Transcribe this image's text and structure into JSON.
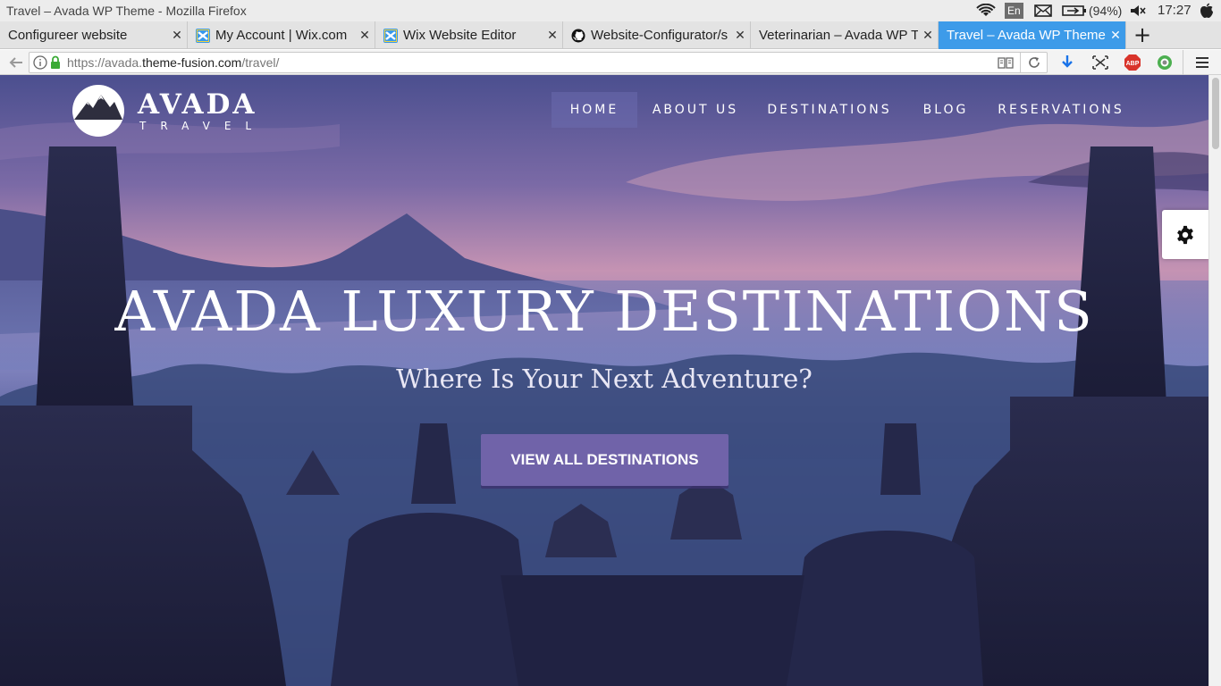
{
  "window": {
    "title": "Travel – Avada WP Theme - Mozilla Firefox"
  },
  "system_tray": {
    "language": "En",
    "battery": "(94%)",
    "clock": "17:27",
    "icons": [
      "wifi-icon",
      "mail-icon",
      "battery-icon",
      "mute-icon",
      "apple-icon"
    ]
  },
  "tabs": [
    {
      "label": "Configureer website",
      "favicon": "none",
      "active": false
    },
    {
      "label": "My Account | Wix.com",
      "favicon": "wix-icon",
      "active": false
    },
    {
      "label": "Wix Website Editor",
      "favicon": "wix-icon",
      "active": false
    },
    {
      "label": "Website-Configurator/s",
      "favicon": "github-icon",
      "active": false
    },
    {
      "label": "Veterinarian – Avada WP T",
      "favicon": "none",
      "active": false
    },
    {
      "label": "Travel – Avada WP Theme",
      "favicon": "none",
      "active": true
    }
  ],
  "address_bar": {
    "url_prefix": "https://avada.",
    "url_domain": "theme-fusion.com",
    "url_path": "/travel/"
  },
  "site": {
    "logo_title": "AVADA",
    "logo_subtitle": "TRAVEL",
    "nav": [
      {
        "label": "HOME",
        "active": true
      },
      {
        "label": "ABOUT US",
        "active": false
      },
      {
        "label": "DESTINATIONS",
        "active": false
      },
      {
        "label": "BLOG",
        "active": false
      },
      {
        "label": "RESERVATIONS",
        "active": false
      }
    ],
    "hero_title": "AVADA LUXURY DESTINATIONS",
    "hero_subtitle": "Where Is Your Next Adventure?",
    "cta_label": "VIEW ALL DESTINATIONS"
  },
  "colors": {
    "accent": "#7063a9",
    "active_tab": "#3d9be9",
    "sky_top": "#5a5a9c",
    "sky_mid": "#b58aa8"
  }
}
